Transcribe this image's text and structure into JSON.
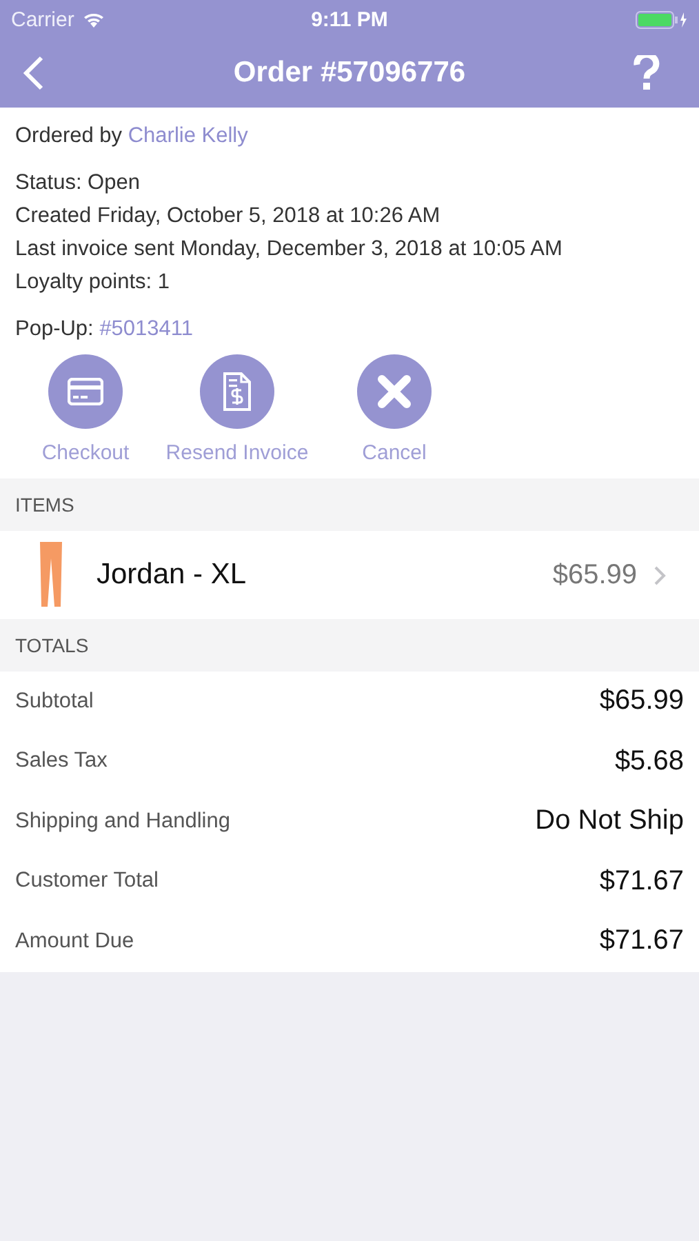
{
  "status_bar": {
    "carrier": "Carrier",
    "time": "9:11 PM"
  },
  "nav": {
    "title": "Order #57096776"
  },
  "ordered_by": {
    "label": "Ordered by",
    "name": "Charlie Kelly"
  },
  "details": [
    "Status: Open",
    "Created Friday, October 5, 2018 at 10:26 AM",
    "Last invoice sent Monday, December 3, 2018 at 10:05 AM",
    "Loyalty points: 1"
  ],
  "popup": {
    "label": "Pop-Up:",
    "link": "#5013411"
  },
  "actions": [
    {
      "kind": "card",
      "label": "Checkout"
    },
    {
      "kind": "invoice",
      "label": "Resend Invoice"
    },
    {
      "kind": "cancel",
      "label": "Cancel"
    }
  ],
  "items_header": "ITEMS",
  "items": [
    {
      "name": "Jordan - XL",
      "price": "$65.99"
    }
  ],
  "totals_header": "TOTALS",
  "totals": [
    {
      "label": "Subtotal",
      "value": "$65.99"
    },
    {
      "label": "Sales Tax",
      "value": "$5.68"
    },
    {
      "label": "Shipping and Handling",
      "value": "Do Not Ship"
    },
    {
      "label": "Customer Total",
      "value": "$71.67"
    },
    {
      "label": "Amount Due",
      "value": "$71.67"
    }
  ]
}
